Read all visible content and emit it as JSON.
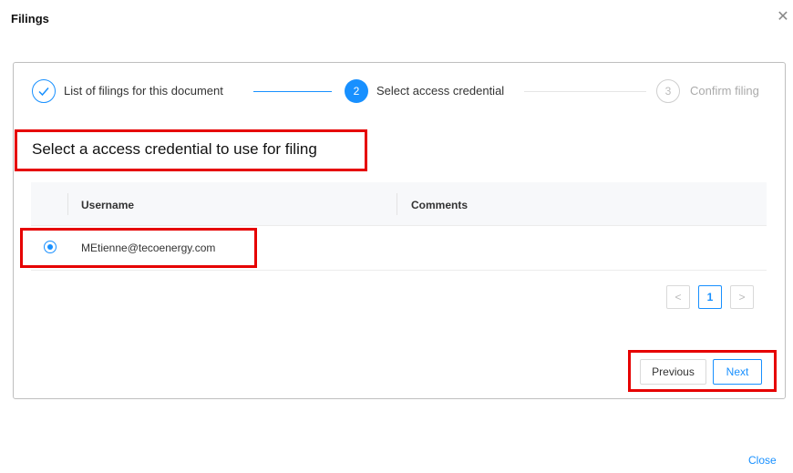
{
  "modal": {
    "title": "Filings",
    "close_label": "Close"
  },
  "steps": [
    {
      "label": "List of filings for this document",
      "state": "done"
    },
    {
      "number": "2",
      "label": "Select access credential",
      "state": "active"
    },
    {
      "number": "3",
      "label": "Confirm filing",
      "state": "pending"
    }
  ],
  "heading": "Select a access credential to use for filing",
  "table": {
    "columns": [
      "Username",
      "Comments"
    ],
    "rows": [
      {
        "selected": true,
        "username": "MEtienne@tecoenergy.com",
        "comments": ""
      }
    ]
  },
  "pagination": {
    "current": "1"
  },
  "actions": {
    "previous": "Previous",
    "next": "Next"
  },
  "colors": {
    "accent": "#1890ff",
    "highlight": "#e60000"
  }
}
